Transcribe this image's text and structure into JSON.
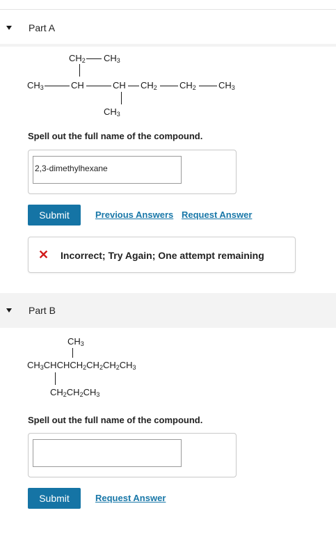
{
  "part_a": {
    "title": "Part A",
    "structure": {
      "top": "CH2—CH3",
      "main": [
        "CH3",
        "CH",
        "CH",
        "CH2",
        "CH2",
        "CH3"
      ],
      "bottom": "CH3"
    },
    "prompt": "Spell out the full name of the compound.",
    "answer_value": "2,3-dimethylhexane",
    "submit_label": "Submit",
    "previous_answers_label": "Previous Answers",
    "request_answer_label": "Request Answer",
    "feedback": {
      "icon": "x-icon",
      "text": "Incorrect; Try Again; One attempt remaining",
      "color": "#d11a1a"
    }
  },
  "part_b": {
    "title": "Part B",
    "structure": {
      "top": "CH3",
      "main": "CH3CHCHCH2CH2CH2CH3",
      "bottom": "CH2CH2CH3"
    },
    "prompt": "Spell out the full name of the compound.",
    "answer_value": "",
    "submit_label": "Submit",
    "request_answer_label": "Request Answer"
  },
  "colors": {
    "button": "#1574a5",
    "link": "#1877a8",
    "error": "#d11a1a",
    "header_band": "#f3f3f3"
  }
}
